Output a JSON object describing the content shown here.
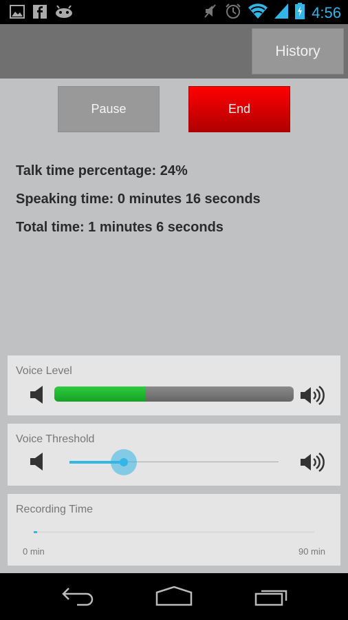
{
  "status_bar": {
    "notification_icons": [
      "image-notification-icon",
      "facebook-icon",
      "android-icon"
    ],
    "system_icons": [
      "mute-icon",
      "alarm-icon",
      "wifi-icon",
      "signal-icon",
      "battery-charging-icon"
    ],
    "time": "4:56",
    "accent_color": "#33b5e5"
  },
  "action_bar": {
    "history_label": "History"
  },
  "controls": {
    "pause_label": "Pause",
    "end_label": "End",
    "end_color": "#e00000"
  },
  "stats": {
    "talk_percentage": "Talk time percentage: 24%",
    "speaking_time": "Speaking time: 0 minutes 16 seconds",
    "total_time": "Total time: 1 minutes 6 seconds"
  },
  "voice_level": {
    "title": "Voice Level",
    "level_percent": 38,
    "fill_color": "#22b532"
  },
  "voice_threshold": {
    "title": "Voice Threshold",
    "value_percent": 26
  },
  "recording_time": {
    "title": "Recording Time",
    "min_label": "0 min",
    "max_label": "90 min",
    "elapsed_minutes": 1.1,
    "max_minutes": 90
  },
  "nav_bar": {
    "buttons": [
      "back",
      "home",
      "recent-apps"
    ]
  }
}
